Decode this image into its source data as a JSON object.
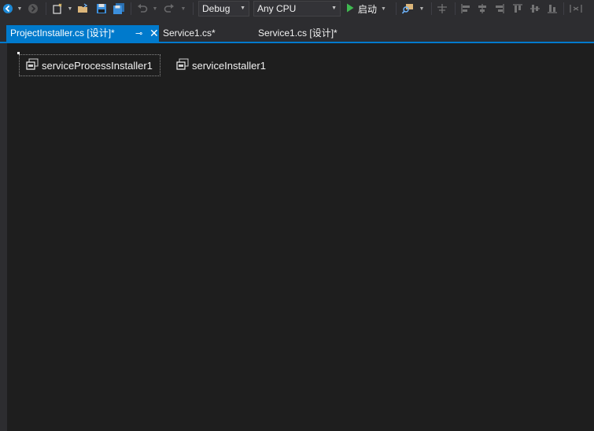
{
  "toolbar": {
    "configuration": "Debug",
    "platform": "Any CPU",
    "start_label": "启动",
    "icons": [
      "back-icon",
      "forward-icon",
      "new-project-icon",
      "open-file-icon",
      "save-icon",
      "save-all-icon",
      "undo-icon",
      "redo-icon",
      "play-icon",
      "find-icon",
      "align-icons"
    ]
  },
  "tabs": [
    {
      "label": "ProjectInstaller.cs [设计]*",
      "active": true
    },
    {
      "label": "Service1.cs*",
      "active": false
    },
    {
      "label": "Service1.cs [设计]*",
      "active": false
    }
  ],
  "designer": {
    "components": [
      {
        "label": "serviceProcessInstaller1",
        "selected": true,
        "icon": "installer-component-icon"
      },
      {
        "label": "serviceInstaller1",
        "selected": false,
        "icon": "installer-component-icon"
      }
    ]
  },
  "colors": {
    "accent": "#007acc",
    "surface": "#1e1e1e",
    "chrome": "#2d2d30",
    "play": "#3fb950"
  }
}
